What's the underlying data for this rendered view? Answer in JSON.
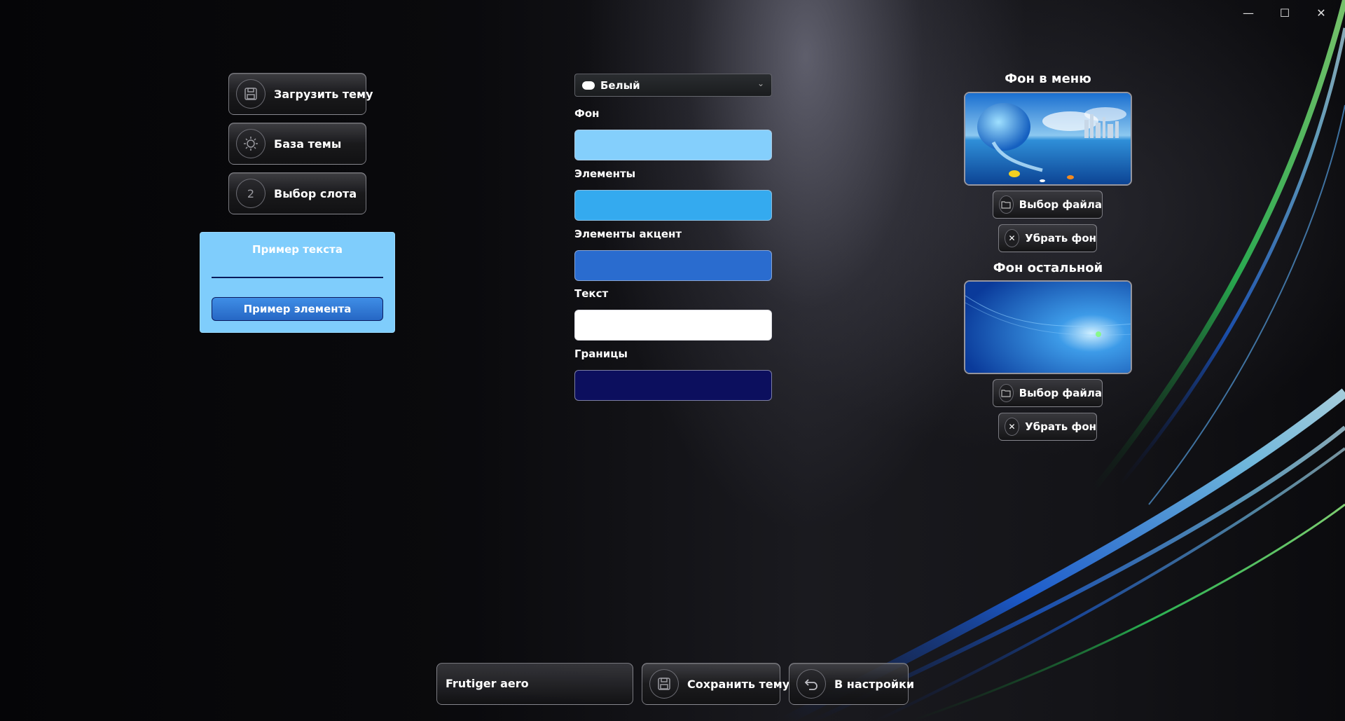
{
  "window": {
    "minimize_icon": "minimize-icon",
    "maximize_icon": "maximize-icon",
    "close_icon": "close-icon"
  },
  "left": {
    "load_theme": {
      "label": "Загрузить тему",
      "icon": "floppy-disk-icon"
    },
    "theme_base": {
      "label": "База темы",
      "icon": "sun-icon"
    },
    "slot_select": {
      "label": "Выбор слота",
      "icon_text": "2"
    }
  },
  "preview": {
    "text_sample": "Пример текста",
    "element_sample": "Пример элемента",
    "background_color": "#7fcdfc",
    "element_color": "#2f7bd6",
    "border_color": "#0a1a5a"
  },
  "middle": {
    "preset": {
      "value": "Белый"
    },
    "fields": [
      {
        "label": "Фон",
        "color": "#84cffc"
      },
      {
        "label": "Элементы",
        "color": "#34aaef"
      },
      {
        "label": "Элементы акцент",
        "color": "#2a6ccf"
      },
      {
        "label": "Текст",
        "color": "#ffffff"
      },
      {
        "label": "Границы",
        "color": "#0c0f5e"
      }
    ]
  },
  "right": {
    "menu_bg": {
      "title": "Фон в меню",
      "choose_file": "Выбор файла",
      "remove_bg": "Убрать фон"
    },
    "other_bg": {
      "title": "Фон остальной",
      "choose_file": "Выбор файла",
      "remove_bg": "Убрать фон"
    }
  },
  "bottom": {
    "theme_name": "Frutiger aero",
    "save_theme": "Сохранить тему",
    "to_settings": "В настройки"
  }
}
